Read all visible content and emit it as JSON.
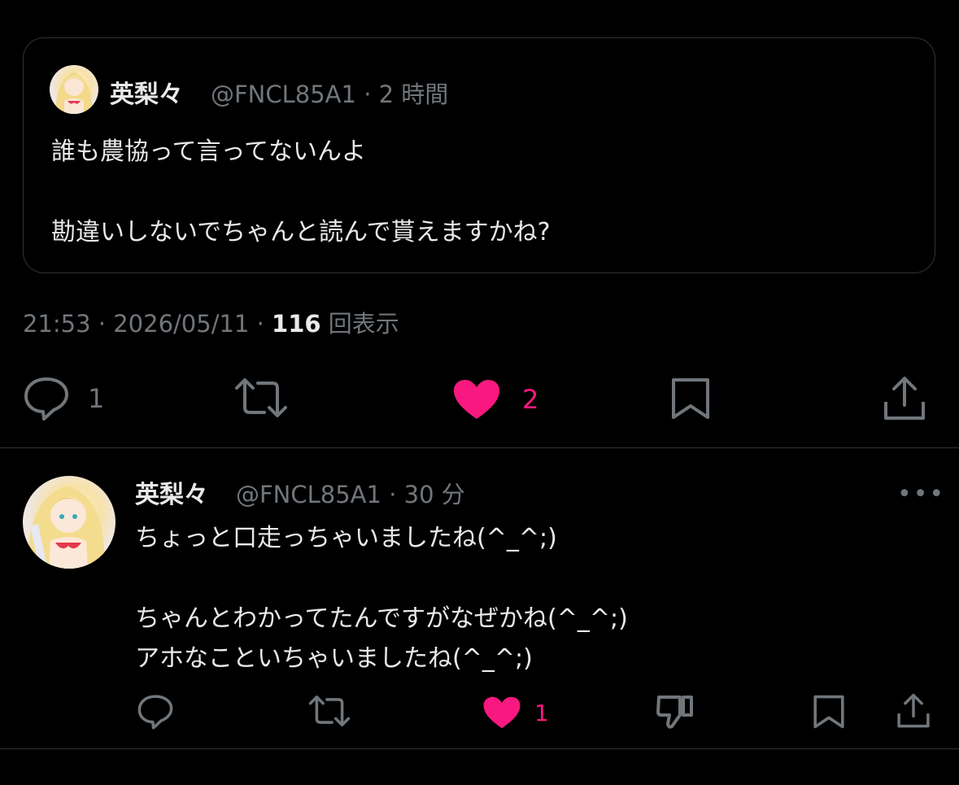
{
  "quoted": {
    "name": "英梨々",
    "handle_time": "@FNCL85A1 · 2 時間",
    "line1": "誰も農協って言ってないんよ",
    "line2": "勘違いしないでちゃんと読んで貰えますかね?"
  },
  "meta": {
    "time": "21:53 · 2026/05/11 · ",
    "views": "116",
    "views_label": " 回表示"
  },
  "main_actions": {
    "reply_count": "1",
    "like_count": "2"
  },
  "reply": {
    "name": "英梨々",
    "handle_time": "@FNCL85A1 · 30 分",
    "line1": "ちょっと口走っちゃいましたね(^_^;)",
    "line2": "ちゃんとわかってたんですがなぜかね(^_^;)",
    "line3": "アホなこといちゃいましたね(^_^;)",
    "more": "•••",
    "like_count": "1"
  },
  "colors": {
    "like_pink": "#f91880",
    "muted": "#71767b",
    "text": "#e7e9ea"
  }
}
